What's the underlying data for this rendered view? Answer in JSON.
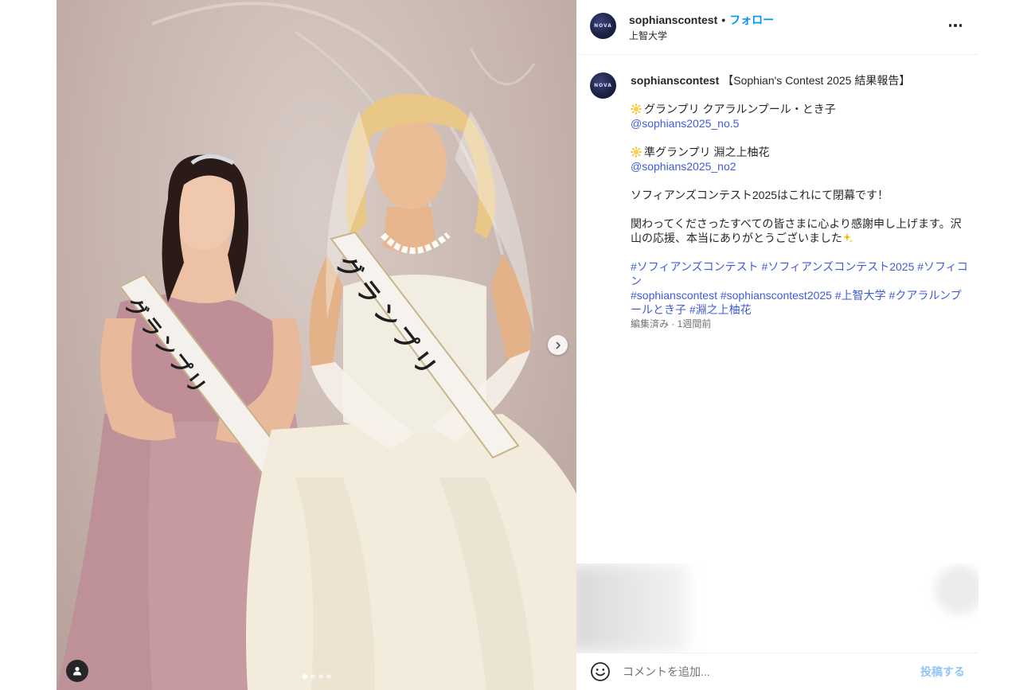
{
  "post": {
    "username": "sophianscontest",
    "follow_label": "フォロー",
    "location": "上智大学",
    "avatar_text": "NOVA"
  },
  "caption": {
    "username": "sophianscontest",
    "title": "【Sophian's Contest 2025 結果報告】",
    "grand_prix": "グランプリ クアラルンプール・とき子",
    "grand_prix_mention": "@sophians2025_no.5",
    "runner_up": "準グランプリ 淵之上柚花",
    "runner_up_mention": "@sophians2025_no2",
    "closing": "ソフィアンズコンテスト2025はこれにて閉幕です！",
    "thanks": "関わってくださったすべての皆さまに心より感謝申し上げます。沢山の応援、本当にありがとうございました",
    "hashtags_line1": "#ソフィアンズコンテスト #ソフィアンズコンテスト2025 #ソフィコン",
    "hashtags_line2": "#sophianscontest #sophianscontest2025 #上智大学 #クアラルンプールとき子 #淵之上柚花",
    "meta": "編集済み · 1週間前"
  },
  "media": {
    "sash_left": "グランプリ",
    "sash_right": "グランプリ",
    "carousel_count": 4,
    "carousel_active": 1
  },
  "comment": {
    "placeholder": "コメントを追加...",
    "post_label": "投稿する"
  },
  "icons": [
    "more-icon",
    "chevron-right-icon",
    "user-tag-icon",
    "sun-icon",
    "sparkle-icon",
    "emoji-icon"
  ],
  "colors": {
    "link": "#3f5bd9",
    "follow": "#0095f6",
    "post_disabled": "#93c5fd"
  }
}
